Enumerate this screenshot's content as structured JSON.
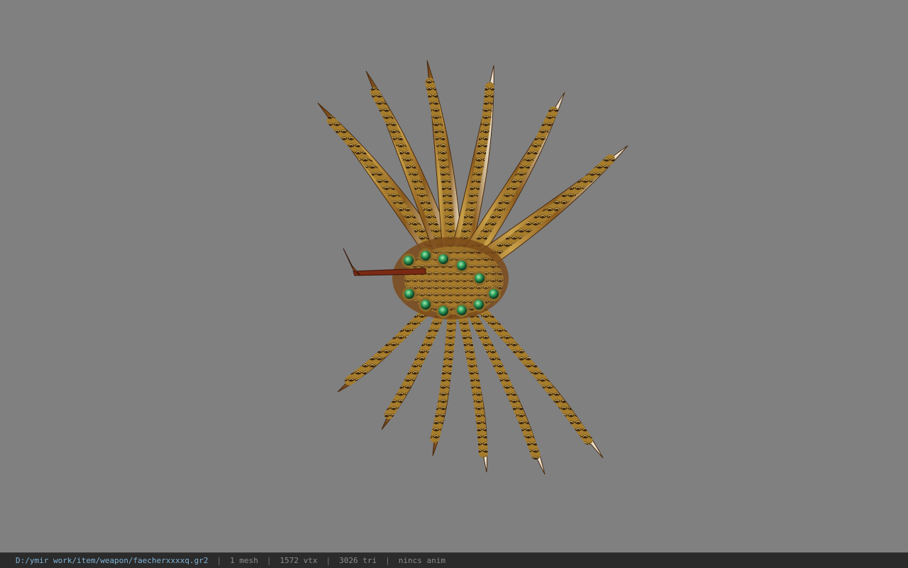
{
  "status_bar": {
    "file_path": "D:/ymir work/item/weapon/faecherxxxxq.gr2",
    "separator": "|",
    "mesh_count": "1 mesh",
    "vertex_count": "1572 vtx",
    "triangle_count": "3026 tri",
    "animation": "nincs anim"
  },
  "viewport": {
    "background_color": "#808080",
    "model_subject": "fan-weapon-model",
    "blade_color": "#c9a14a",
    "gem_color": "#2f9a5a"
  }
}
